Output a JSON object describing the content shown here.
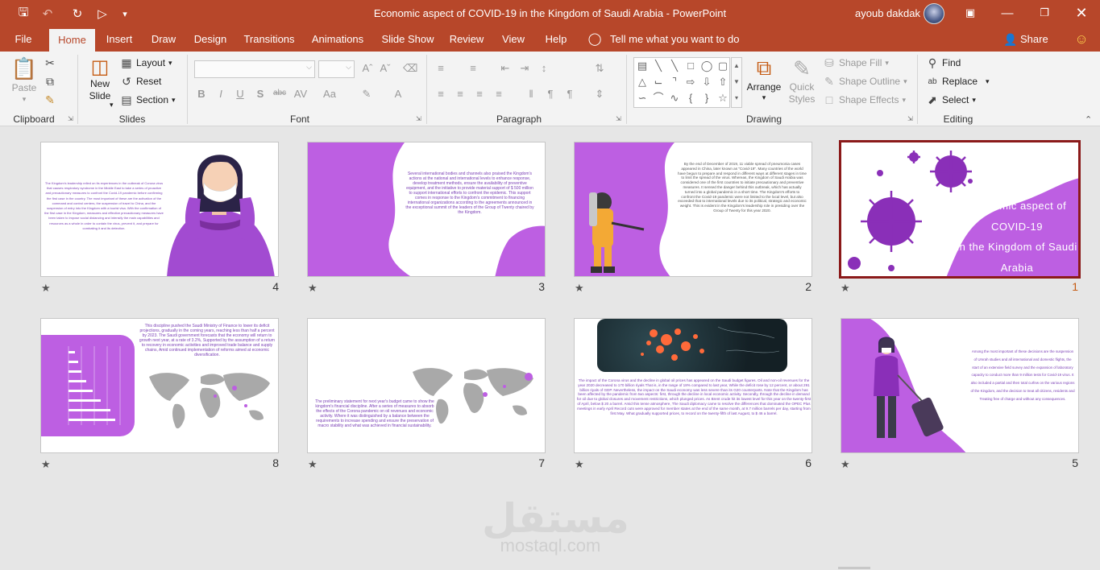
{
  "title_bar": {
    "doc_title": "Economic aspect of COVID-19 in the Kingdom of Saudi Arabia  -  PowerPoint",
    "user_name": "ayoub dakdak",
    "save_icon": "save-icon",
    "undo_icon": "undo-icon",
    "redo_icon": "redo-icon",
    "present_icon": "start-from-beginning-icon",
    "customize_icon": "chevron-down-icon"
  },
  "tabs": [
    {
      "label": "File"
    },
    {
      "label": "Home"
    },
    {
      "label": "Insert"
    },
    {
      "label": "Draw"
    },
    {
      "label": "Design"
    },
    {
      "label": "Transitions"
    },
    {
      "label": "Animations"
    },
    {
      "label": "Slide Show"
    },
    {
      "label": "Review"
    },
    {
      "label": "View"
    },
    {
      "label": "Help"
    }
  ],
  "active_tab": "Home",
  "tell_me": "Tell me what you want to do",
  "share": "Share",
  "ribbon": {
    "clipboard": {
      "label": "Clipboard",
      "paste": "Paste"
    },
    "slides": {
      "label": "Slides",
      "new_slide": "New",
      "new_slide2": "Slide",
      "layout": "Layout",
      "reset": "Reset",
      "section": "Section"
    },
    "font": {
      "label": "Font",
      "bold": "B",
      "italic": "I",
      "underline": "U",
      "shadow": "S",
      "strike": "abc",
      "case": "Aa"
    },
    "paragraph": {
      "label": "Paragraph"
    },
    "drawing": {
      "label": "Drawing",
      "arrange": "Arrange",
      "quick_styles": "Quick",
      "quick_styles2": "Styles",
      "shape_fill": "Shape Fill",
      "shape_outline": "Shape Outline",
      "shape_effects": "Shape Effects"
    },
    "editing": {
      "label": "Editing",
      "find": "Find",
      "replace": "Replace",
      "select": "Select"
    }
  },
  "accent_color": "#b7472a",
  "slide_accent_color": "#bd5fe2",
  "slides": [
    {
      "number": "1",
      "title_lines": [
        "Economic aspect of",
        "COVID-19",
        "in the Kingdom of Saudi",
        "Arabia"
      ]
    },
    {
      "number": "2",
      "text": "By the end of December of 2019, 11 viable spread of pneumonia cases appeared in China, later known as \"Covid-19\". Many countries of the world have begun to prepare and respond in different ways at different stages in time to limit the spread of the virus. Whereas, the Kingdom of Saudi Arabia was considered one of the first countries to initiate precautionary and preventive measures. It sensed the danger behind this outbreak, which has actually turned into a global pandemic in a short time. The Kingdom's efforts to confront the Covid-19 pandemic were not limited to the local level, but also exceeded that to international levels due to its political, strategic and economic weight. This is evident in the Kingdom's leadership role in presiding over the Group of Twenty for this year 2020."
    },
    {
      "number": "3",
      "text": "Several international bodies and channels also praised the Kingdom's actions at the national and international levels to enhance response, develop treatment methods, ensure the availability of preventive equipment, and the initiative to provide material support of $ 500 million to support international efforts to confront the epidemic. This support comes in response to the Kingdom's commitment to financing international organizations according to the agreements announced in the exceptional summit of the leaders of the Group of Twenty chaired by the Kingdom."
    },
    {
      "number": "4",
      "text": "The Kingdom's leadership relied on its experiences in the outbreak of Corona virus that causes respiratory syndrome in the Middle East to take a series of proactive and precautionary measures to confront the Covid-19 pandemic before confirming the first case in the country. The most important of these are the activation of the command and control centers, the suspension of travel to China, and the suspension of entry into the Kingdom with a tourist visa. With the confirmation of the first case in the Kingdom, measures and effective precautionary measures have been taken to impose social distancing and intensify the main capabilities and resources as a whole in order to contain the virus, prevent it, and prepare for combating it and its detection."
    },
    {
      "number": "5",
      "text": "Among the most important of these decisions are the suspension of Umrah studies and all international and domestic flights, the start of an extensive field survey and the expansion of laboratory capacity to conduct more than 9 million tests for Covid-19 virus. It also included a partial and then total curfew on the various regions of the Kingdom, and the decision to treat all citizens, residents and Treating free of charge and without any consequences."
    },
    {
      "number": "6",
      "text": "The impact of the Corona virus and the decline in global oil prices has appeared on the Saudi budget figures. Oil and non-oil revenues for the year 2020 decreased to 170 billion riyals That is, in the range of 18% compared to last year, While the deficit rose by 12 percent, or about 291 billion riyals of GDP. Nevertheless, the impact on the Saudi economy was less severe than its G20 counterparts. Note that the Kingdom has been affected by the pandemic from two aspects: first, through the decline in local economic activity. Secondly, through the decline in demand for oil due to global closures and movement restrictions, which plunged prices. As Brent crude hit its lowest level for this year on the twenty-first of April, below $ 20 a barrel. Amid this tense atmosphere, The Saudi diplomacy came to resolve the differences that dominated the OPEC Plus meetings in early April Record cuts were approved for member states at the end of the same month, at 9.7 million barrels per day, starting from first May. What gradually supported prices, to record on the twenty-fifth of last August, to $ 46 a barrel."
    },
    {
      "number": "7",
      "text": "The preliminary statement for next year's budget came to show the kingdom's financial discipline. After a series of measures to absorb the effects of the Corona pandemic on oil revenues and economic activity. Where it was distinguished by a balance between the requirements to increase spending and ensure the preservation of macro stability and what was achieved in financial sustainability."
    },
    {
      "number": "8",
      "text": "This discipline pushed the Saudi Ministry of Finance to lower its deficit projections, gradually in the coming years, reaching less than half a percent by 2023. The Saudi government forecasts that the economy will return to growth next year, at a rate of 3.2%, Supported by the assumption of a return to recovery in economic activities and improved trade balance and supply chains, Amid continued implementation of reforms aimed at economic diversification."
    }
  ],
  "watermark": {
    "arabic": "مستقل",
    "latin": "mostaql.com"
  }
}
